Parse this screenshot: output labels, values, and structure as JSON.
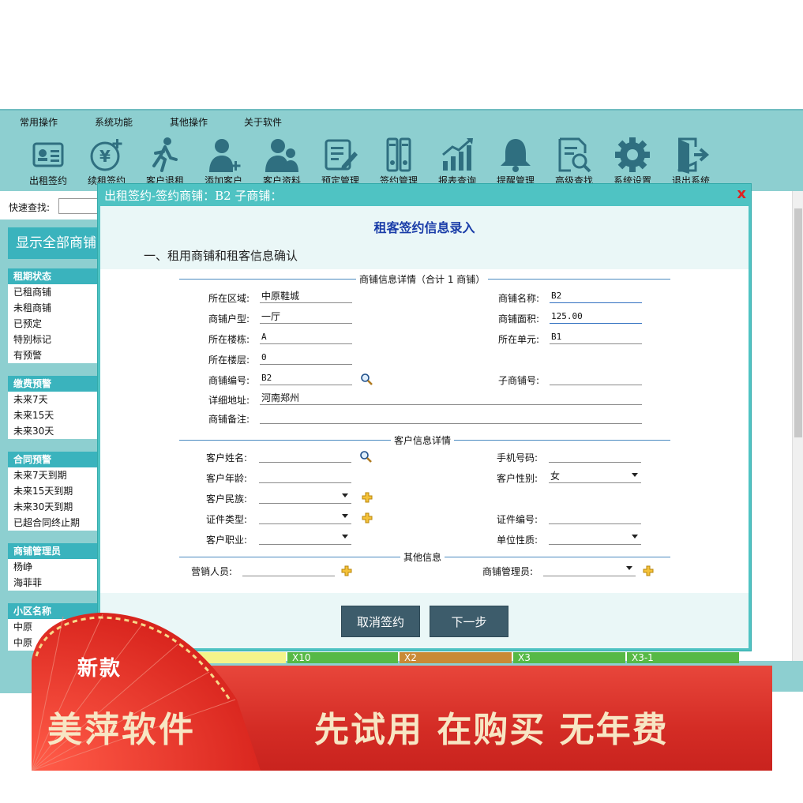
{
  "menu": [
    "常用操作",
    "系统功能",
    "其他操作",
    "关于软件"
  ],
  "toolbar": [
    {
      "label": "出租签约",
      "icon": "contract-icon"
    },
    {
      "label": "续租签约",
      "icon": "renew-yen-icon"
    },
    {
      "label": "客户退租",
      "icon": "walking-person-icon"
    },
    {
      "label": "添加客户",
      "icon": "add-user-icon"
    },
    {
      "label": "客户资料",
      "icon": "users-icon"
    },
    {
      "label": "预定管理",
      "icon": "edit-document-icon"
    },
    {
      "label": "签约管理",
      "icon": "binders-icon"
    },
    {
      "label": "报表查询",
      "icon": "chart-icon"
    },
    {
      "label": "提醒管理",
      "icon": "bell-icon"
    },
    {
      "label": "高级查找",
      "icon": "document-search-icon"
    },
    {
      "label": "系统设置",
      "icon": "gear-icon"
    },
    {
      "label": "退出系统",
      "icon": "exit-icon"
    }
  ],
  "quick_search": {
    "label": "快速查找:"
  },
  "sidebar": {
    "show_all": "显示全部商铺",
    "groups": [
      {
        "title": "租期状态",
        "items": [
          "已租商铺",
          "未租商铺",
          "已预定",
          "特别标记",
          "有预警"
        ]
      },
      {
        "title": "缴费预警",
        "items": [
          "未来7天",
          "未来15天",
          "未来30天"
        ]
      },
      {
        "title": "合同预警",
        "items": [
          "未来7天到期",
          "未来15天到期",
          "未来30天到期",
          "已超合同终止期"
        ]
      },
      {
        "title": "商铺管理员",
        "items": [
          "杨峥",
          "海菲菲"
        ]
      },
      {
        "title": "小区名称",
        "items": [
          "中原",
          "中原"
        ]
      }
    ]
  },
  "bg_cells": [
    "X10",
    "X2",
    "X3",
    "X3-1"
  ],
  "dialog": {
    "title": "出租签约-签约商铺：B2      子商铺：",
    "close": "x",
    "heading": "租客签约信息录入",
    "section": "一、租用商铺和租客信息确认",
    "shop_legend": "商铺信息详情（合计 1 商铺）",
    "customer_legend": "客户信息详情",
    "other_legend": "其他信息",
    "shop": {
      "region_label": "所在区域:",
      "region": "中原鞋城",
      "name_label": "商铺名称:",
      "name": "B2",
      "type_label": "商铺户型:",
      "type": "一厅",
      "area_label": "商铺面积:",
      "area": "125.00",
      "building_label": "所在楼栋:",
      "building": "A",
      "unit_label": "所在单元:",
      "unit": "B1",
      "floor_label": "所在楼层:",
      "floor": "0",
      "code_label": "商铺编号:",
      "code": "B2",
      "sub_label": "子商铺号:",
      "sub": "",
      "address_label": "详细地址:",
      "address": "河南郑州",
      "remark_label": "商铺备注:",
      "remark": ""
    },
    "customer": {
      "name_label": "客户姓名:",
      "name": "",
      "phone_label": "手机号码:",
      "phone": "",
      "age_label": "客户年龄:",
      "age": "",
      "gender_label": "客户性别:",
      "gender": "女",
      "ethnic_label": "客户民族:",
      "ethnic": "",
      "idtype_label": "证件类型:",
      "idtype": "",
      "idno_label": "证件编号:",
      "idno": "",
      "job_label": "客户职业:",
      "job": "",
      "org_label": "单位性质:",
      "org": ""
    },
    "other": {
      "sales_label": "营销人员:",
      "sales": "",
      "manager_label": "商铺管理员:",
      "manager": ""
    },
    "buttons": {
      "cancel": "取消签约",
      "next": "下一步"
    }
  },
  "banner": {
    "tag": "新款",
    "brand": "美萍软件",
    "slogan": "先试用 在购买 无年费"
  },
  "colors": {
    "teal": "#8dcfd0",
    "dialog": "#4fc3c3",
    "heading": "#1a3da8",
    "button": "#3d5c6b",
    "banner": "#d42c25"
  }
}
